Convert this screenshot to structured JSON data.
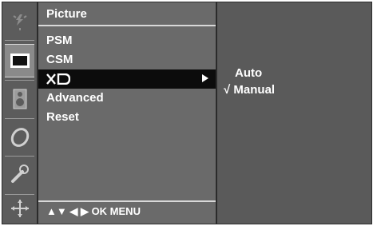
{
  "colors": {
    "panel": "#6a6a6a",
    "icon_column": "#5c5c5c",
    "submenu": "#5a5a5a",
    "selected_row": "#0c0c0c",
    "text": "#ffffff"
  },
  "sidebar": {
    "icons": [
      {
        "name": "picture-icon",
        "active": false
      },
      {
        "name": "screen-icon",
        "active": true
      },
      {
        "name": "speaker-icon",
        "active": false
      },
      {
        "name": "clock-icon",
        "active": false
      },
      {
        "name": "wrench-icon",
        "active": false
      },
      {
        "name": "navigation-icon",
        "active": false
      }
    ]
  },
  "menu": {
    "title": "Picture",
    "items": [
      {
        "label": "PSM"
      },
      {
        "label": "CSM"
      },
      {
        "label": "XD",
        "selected": true,
        "has_submenu": true
      },
      {
        "label": "Advanced"
      },
      {
        "label": "Reset"
      }
    ],
    "hint": "▲▼  ◀ ▶  OK  MENU"
  },
  "submenu": {
    "options": [
      {
        "label": "Auto",
        "checked": false
      },
      {
        "label": "Manual",
        "checked": true,
        "mark": "√"
      }
    ]
  }
}
